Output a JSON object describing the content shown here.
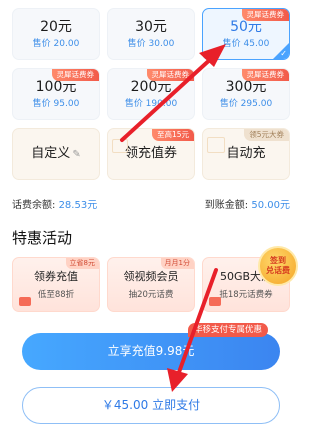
{
  "denominations": [
    {
      "amount": "20元",
      "price": "售价 20.00",
      "tag": ""
    },
    {
      "amount": "30元",
      "price": "售价 30.00",
      "tag": ""
    },
    {
      "amount": "50元",
      "price": "售价 45.00",
      "tag": "灵犀话费券",
      "selected": true
    },
    {
      "amount": "100元",
      "price": "售价 95.00",
      "tag": "灵犀话费券"
    },
    {
      "amount": "200元",
      "price": "售价 190.00",
      "tag": "灵犀话费券"
    },
    {
      "amount": "300元",
      "price": "售价 295.00",
      "tag": "灵犀话费券"
    }
  ],
  "specials": [
    {
      "label": "自定义",
      "tag": ""
    },
    {
      "label": "领充值券",
      "tag": "至高15元"
    },
    {
      "label": "自动充",
      "tag": "领5元大券"
    }
  ],
  "balance": {
    "label": "话费余额:",
    "value": "28.53元"
  },
  "arrival": {
    "label": "到账金额:",
    "value": "50.00元"
  },
  "section_title": "特惠活动",
  "promos": [
    {
      "title": "领券充值",
      "sub": "低至88折",
      "tag": "立省8元"
    },
    {
      "title": "领视频会员",
      "sub": "抽20元话费",
      "tag": "月月1分"
    },
    {
      "title": "50GB大流",
      "sub": "抵18元话费券",
      "tag": ""
    }
  ],
  "badge": {
    "line1": "签到",
    "line2": "兑话费"
  },
  "pay_badge": "华移支付专属优惠",
  "btn_enjoy": "立享充值9.98元",
  "btn_pay": "￥45.00  立即支付",
  "colors": {
    "accent_blue": "#3b85f0",
    "tag_red": "#f25a4a",
    "arrow_red": "#e8202a"
  }
}
